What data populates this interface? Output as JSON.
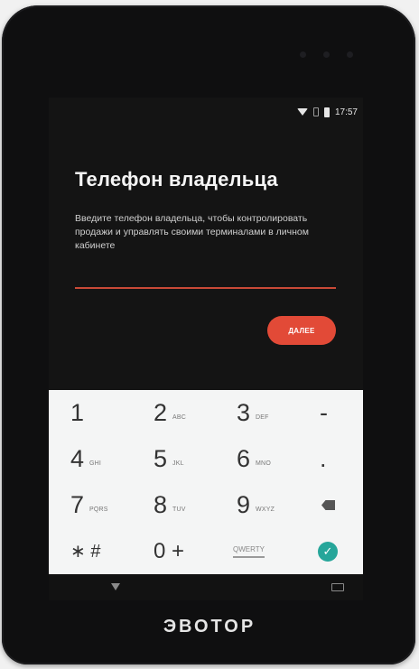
{
  "device": {
    "logo": "ЭВОТОР"
  },
  "status_bar": {
    "time": "17:57"
  },
  "screen": {
    "title": "Телефон владельца",
    "description": "Введите телефон владельца, чтобы контролировать продажи и управлять своими терминалами в личном кабинете",
    "phone_input": {
      "value": ""
    },
    "next_button": "ДАЛЕЕ"
  },
  "keypad": {
    "keys": [
      {
        "digit": "1",
        "letters": ""
      },
      {
        "digit": "2",
        "letters": "ABC"
      },
      {
        "digit": "3",
        "letters": "DEF"
      },
      {
        "digit": "-",
        "letters": ""
      },
      {
        "digit": "4",
        "letters": "GHI"
      },
      {
        "digit": "5",
        "letters": "JKL"
      },
      {
        "digit": "6",
        "letters": "MNO"
      },
      {
        "digit": ".",
        "letters": ""
      },
      {
        "digit": "7",
        "letters": "PQRS"
      },
      {
        "digit": "8",
        "letters": "TUV"
      },
      {
        "digit": "9",
        "letters": "WXYZ"
      }
    ],
    "star_hash": "∗ #",
    "zero_plus": "0 +",
    "language": "QWERTY",
    "delete_icon": "backspace-icon",
    "done_icon": "check-icon"
  }
}
